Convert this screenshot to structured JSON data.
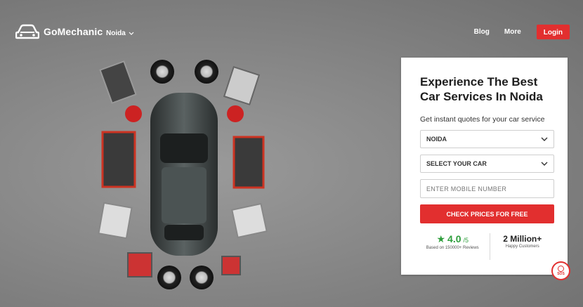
{
  "header": {
    "brand": "GoMechanic",
    "city": "Noida",
    "nav": {
      "blog": "Blog",
      "more": "More",
      "login": "Login"
    }
  },
  "form": {
    "title_line1": "Experience The Best",
    "title_line2": "Car Services In Noida",
    "subtitle": "Get instant quotes for your car service",
    "city_select": "NOIDA",
    "car_select": "SELECT YOUR CAR",
    "mobile_placeholder": "ENTER MOBILE NUMBER",
    "cta": "CHECK PRICES FOR FREE"
  },
  "stats": {
    "rating": "4.0",
    "rating_out_of": "/5",
    "rating_caption": "Based on 150000+ Reviews",
    "customers": "2 Million+",
    "customers_caption": "Happy Customers"
  },
  "sos": {
    "label": "SOS"
  },
  "colors": {
    "accent": "#e22f2f",
    "rating": "#2e9e3c",
    "background": "#888888"
  },
  "icons": [
    "car-logo-icon",
    "chevron-down-icon",
    "star-icon",
    "sos-icon"
  ]
}
